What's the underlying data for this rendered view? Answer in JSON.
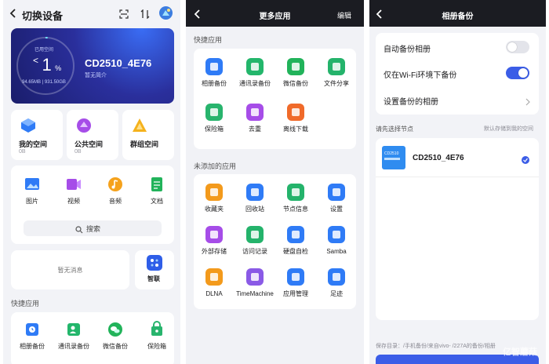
{
  "left": {
    "header_title": "切换设备",
    "device_card": {
      "used_label": "已用空间",
      "percent_prefix": "<",
      "percent_number": "1",
      "percent_sign": "%",
      "usage": "94.65MB | 931.50GB",
      "device_name": "CD2510_4E76",
      "subtitle": "暂无简介",
      "used_fraction": 0.01
    },
    "spaces": [
      {
        "label": "我的空间",
        "count": "0B"
      },
      {
        "label": "公共空间",
        "count": "0B"
      },
      {
        "label": "群组空间",
        "count": ""
      }
    ],
    "media": [
      {
        "label": "图片",
        "icon": "image-icon"
      },
      {
        "label": "视频",
        "icon": "video-icon"
      },
      {
        "label": "音频",
        "icon": "audio-icon"
      },
      {
        "label": "文档",
        "icon": "document-icon"
      }
    ],
    "search_label": "搜索",
    "no_message": "暂无消息",
    "zhilian_label": "智联",
    "quick_title": "快捷应用",
    "quick_apps": [
      "相册备份",
      "通讯录备份",
      "微信备份",
      "保险箱"
    ]
  },
  "middle": {
    "title": "更多应用",
    "edit": "编辑",
    "quick_title": "快捷应用",
    "quick_apps": [
      {
        "label": "相册备份",
        "icon": "photo-backup-icon",
        "color": "#2f7bf6"
      },
      {
        "label": "通讯录备份",
        "icon": "contacts-backup-icon",
        "color": "#23b66b"
      },
      {
        "label": "微信备份",
        "icon": "wechat-backup-icon",
        "color": "#21b35a"
      },
      {
        "label": "文件分享",
        "icon": "file-share-icon",
        "color": "#24b36b"
      },
      {
        "label": "保险箱",
        "icon": "safe-icon",
        "color": "#28b46d"
      },
      {
        "label": "去重",
        "icon": "dedupe-icon",
        "color": "#a64de8"
      },
      {
        "label": "离线下载",
        "icon": "offline-download-icon",
        "color": "#f06a2a"
      }
    ],
    "unadded_title": "未添加的应用",
    "unadded_apps": [
      {
        "label": "收藏夹",
        "icon": "favorites-icon",
        "color": "#f39a1c"
      },
      {
        "label": "回收站",
        "icon": "recycle-bin-icon",
        "color": "#2f7bf6"
      },
      {
        "label": "节点信息",
        "icon": "node-info-icon",
        "color": "#24b36b"
      },
      {
        "label": "设置",
        "icon": "settings-icon",
        "color": "#2f7bf6"
      },
      {
        "label": "外部存储",
        "icon": "external-storage-icon",
        "color": "#a64de8"
      },
      {
        "label": "访问记录",
        "icon": "access-log-icon",
        "color": "#24b36b"
      },
      {
        "label": "硬盘自检",
        "icon": "disk-check-icon",
        "color": "#2f7bf6"
      },
      {
        "label": "Samba",
        "icon": "samba-icon",
        "color": "#2f7bf6"
      },
      {
        "label": "DLNA",
        "icon": "dlna-icon",
        "color": "#f39a1c"
      },
      {
        "label": "TimeMachine",
        "icon": "time-machine-icon",
        "color": "#8a5ae6"
      },
      {
        "label": "应用管理",
        "icon": "app-manage-icon",
        "color": "#2f7bf6"
      },
      {
        "label": "足迹",
        "icon": "footprint-icon",
        "color": "#2f7bf6"
      }
    ]
  },
  "right": {
    "title": "相册备份",
    "settings": [
      {
        "label": "自动备份相册",
        "toggle": "off"
      },
      {
        "label": "仅在Wi-Fi环境下备份",
        "toggle": "on"
      },
      {
        "label": "设置备份的相册",
        "toggle": "chevron"
      }
    ],
    "node_prompt": "请先选择节点",
    "node_default": "默认存储到我的空间",
    "node_name": "CD2510_4E76",
    "node_thumb_text": "CD2510",
    "save_dir_label": "保存目录：",
    "save_dir_path": "/手机备份/来自vivo-  /227A的备份/相册",
    "watermark": "亿智蘑菇"
  },
  "colors": {
    "accent": "#3b5de7",
    "green": "#21b35a"
  }
}
